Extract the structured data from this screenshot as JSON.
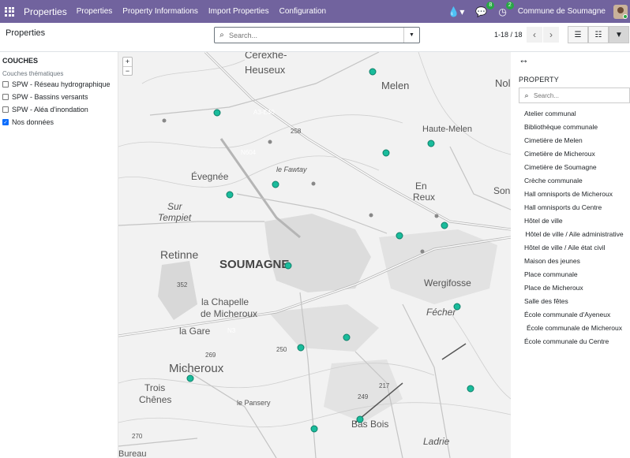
{
  "navbar": {
    "brand": "Properties",
    "menu": [
      "Properties",
      "Property Informations",
      "Import Properties",
      "Configuration"
    ],
    "messages_count": "8",
    "activities_count": "2",
    "company": "Commune de Soumagne"
  },
  "control_panel": {
    "title": "Properties",
    "search_placeholder": "Search...",
    "pager": "1-18 / 18"
  },
  "layers_panel": {
    "title": "COUCHES",
    "subtitle": "Couches thématiques",
    "layers": [
      {
        "label": "SPW - Réseau hydrographique",
        "checked": false
      },
      {
        "label": "SPW - Bassins versants",
        "checked": false
      },
      {
        "label": "SPW - Aléa d'inondation",
        "checked": false
      },
      {
        "label": "Nos données",
        "checked": true
      }
    ]
  },
  "map": {
    "labels": [
      "Cerexhe-",
      "Heuseux",
      "Melen",
      "Nol",
      "Haute-Melen",
      "A3-E40",
      "258",
      "N604",
      "le Fawtay",
      "Évegnée",
      "En",
      "Reux",
      "Son",
      "Sur",
      "Tempiet",
      "Retinne",
      "SOUMAGNE",
      "Wergifosse",
      "352",
      "la Chapelle",
      "de Micheroux",
      "Fécher",
      "la Gare",
      "N3",
      "269",
      "250",
      "Micheroux",
      "Trois",
      "Chênes",
      "217",
      "le Pansery",
      "249",
      "Bas Bois",
      "270",
      "Ladrie",
      "Bureau"
    ],
    "marker_color": "#1abc9c"
  },
  "property_panel": {
    "title": "PROPERTY",
    "search_placeholder": "Search...",
    "items": [
      "Atelier communal",
      "Bibliothèque communale",
      "Cimetière de Melen",
      "Cimetière de Micheroux",
      "Cimetière de Soumagne",
      "Crèche communale",
      "Hall omnisports de Micheroux",
      "Hall omnisports du Centre",
      "Hôtel de ville",
      "Hôtel de ville / Aile administrative",
      "Hôtel de ville / Aile état civil",
      "Maison des jeunes",
      "Place communale",
      "Place de Micheroux",
      "Salle des fêtes",
      "École communale d'Ayeneux",
      "École communale de Micheroux",
      "École communale du Centre"
    ]
  }
}
